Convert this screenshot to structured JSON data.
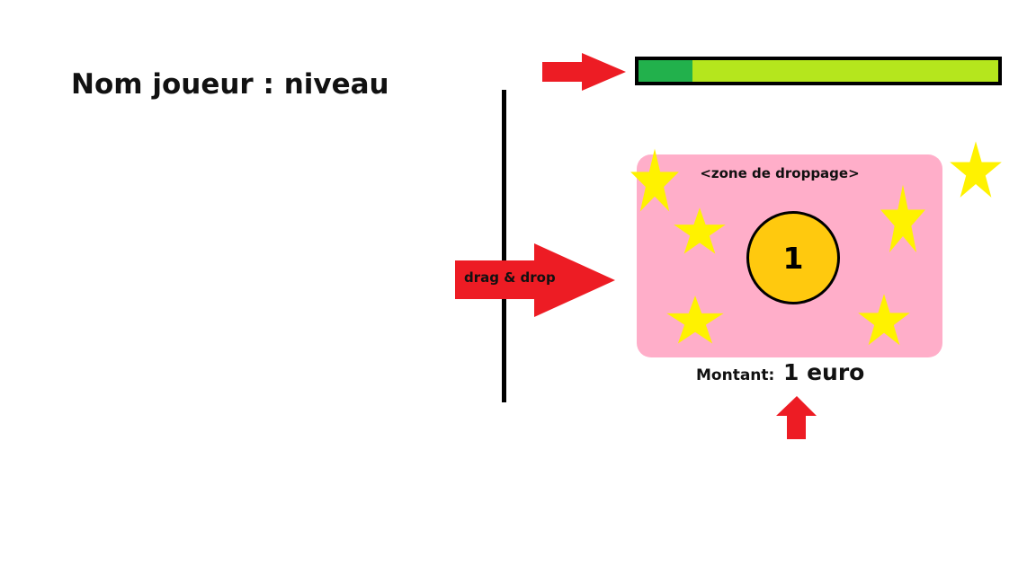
{
  "header": {
    "player_label": "Nom joueur : niveau"
  },
  "progress": {
    "fraction": 0.15,
    "fill_color": "#22b14c",
    "track_color": "#b5e61d"
  },
  "drag_drop": {
    "label": "drag & drop",
    "arrow_color": "#ed1c24"
  },
  "drop_zone": {
    "label": "<zone de droppage>",
    "background": "#ffaec9",
    "coin_value": "1",
    "coin_color": "#ffc90e",
    "star_color": "#fff200"
  },
  "amount": {
    "label": "Montant:",
    "value": "1 euro"
  },
  "icons": {
    "progress_pointer": "arrow-right-icon",
    "drag_arrow": "arrow-right-icon",
    "amount_pointer": "arrow-up-icon",
    "decoration": "star-icon"
  }
}
